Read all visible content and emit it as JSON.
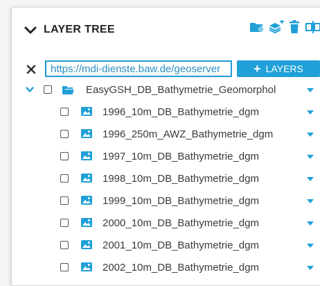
{
  "panel": {
    "title": "LAYER TREE",
    "toolbar": {
      "icons": [
        "folder-add-icon",
        "layers-add-icon",
        "trash-icon",
        "split-icon"
      ]
    }
  },
  "url_row": {
    "url_value": "https://mdi-dienste.baw.de/geoserver",
    "add_button_label": "LAYERS"
  },
  "tree": {
    "group": {
      "label": "EasyGSH_DB_Bathymetrie_Geomorphologie",
      "expanded": true,
      "checked": false
    },
    "layers": [
      {
        "label": "1996_10m_DB_Bathymetrie_dgm",
        "checked": false
      },
      {
        "label": "1996_250m_AWZ_Bathymetrie_dgm",
        "checked": false
      },
      {
        "label": "1997_10m_DB_Bathymetrie_dgm",
        "checked": false
      },
      {
        "label": "1998_10m_DB_Bathymetrie_dgm",
        "checked": false
      },
      {
        "label": "1999_10m_DB_Bathymetrie_dgm",
        "checked": false
      },
      {
        "label": "2000_10m_DB_Bathymetrie_dgm",
        "checked": false
      },
      {
        "label": "2001_10m_DB_Bathymetrie_dgm",
        "checked": false
      },
      {
        "label": "2002_10m_DB_Bathymetrie_dgm",
        "checked": false
      }
    ]
  },
  "colors": {
    "accent": "#20a0d8",
    "input_border": "#1e9bd7",
    "text": "#3a3a3a",
    "icon_dark": "#333333"
  }
}
